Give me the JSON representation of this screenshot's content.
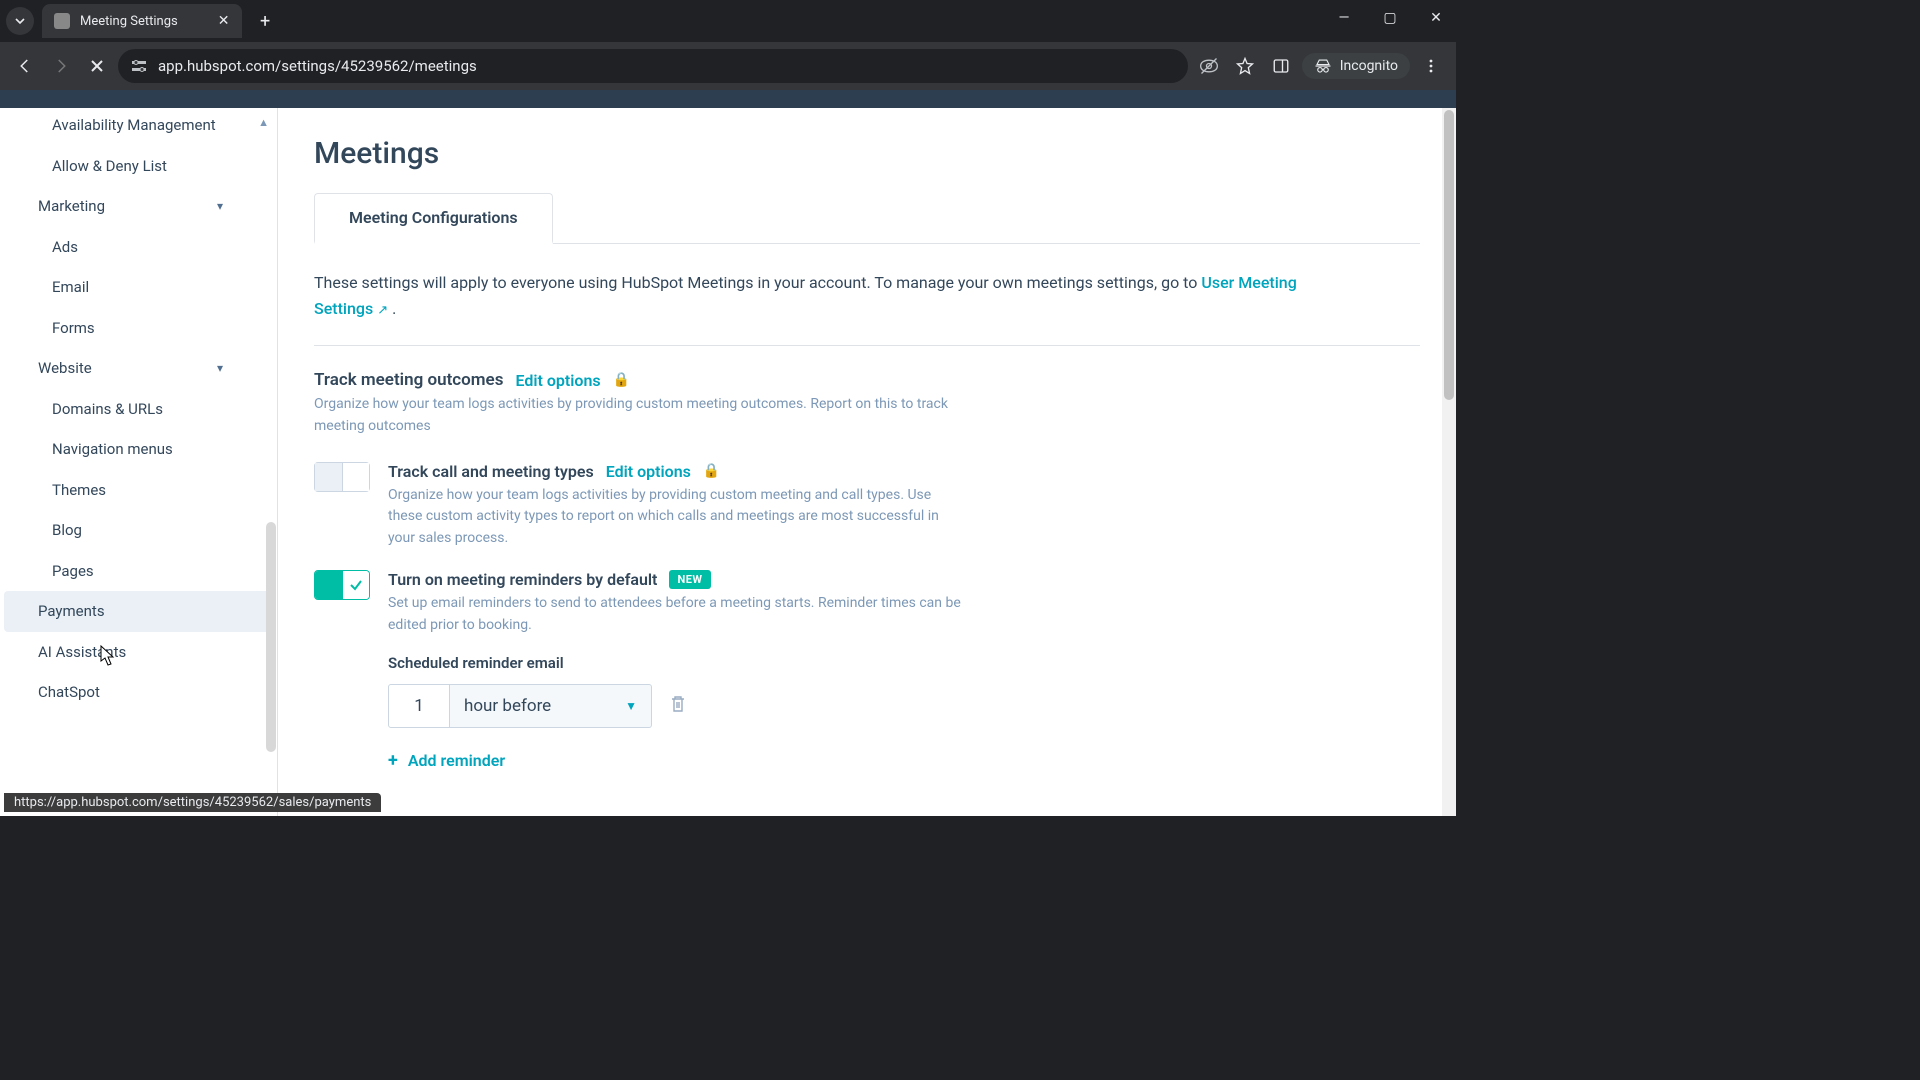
{
  "browser": {
    "tab_title": "Meeting Settings",
    "url": "app.hubspot.com/settings/45239562/meetings",
    "incognito_label": "Incognito",
    "status_url": "https://app.hubspot.com/settings/45239562/sales/payments"
  },
  "sidebar": {
    "items": [
      {
        "label": "Availability Management",
        "type": "leaf"
      },
      {
        "label": "Allow & Deny List",
        "type": "leaf"
      },
      {
        "label": "Marketing",
        "type": "group"
      },
      {
        "label": "Ads",
        "type": "sub"
      },
      {
        "label": "Email",
        "type": "sub"
      },
      {
        "label": "Forms",
        "type": "sub"
      },
      {
        "label": "Website",
        "type": "group"
      },
      {
        "label": "Domains & URLs",
        "type": "sub"
      },
      {
        "label": "Navigation menus",
        "type": "sub"
      },
      {
        "label": "Themes",
        "type": "sub"
      },
      {
        "label": "Blog",
        "type": "sub"
      },
      {
        "label": "Pages",
        "type": "sub"
      },
      {
        "label": "Payments",
        "type": "leaf",
        "active": true
      },
      {
        "label": "AI Assistants",
        "type": "leaf"
      },
      {
        "label": "ChatSpot",
        "type": "leaf"
      }
    ]
  },
  "page": {
    "title": "Meetings",
    "tab_label": "Meeting Configurations",
    "intro_prefix": "These settings will apply to everyone using HubSpot Meetings in your account. To manage your own meetings settings, go to ",
    "intro_link": "User Meeting Settings",
    "intro_suffix": " .",
    "track_outcomes": {
      "title": "Track meeting outcomes",
      "edit": "Edit options",
      "desc": "Organize how your team logs activities by providing custom meeting outcomes. Report on this to track meeting outcomes"
    },
    "track_types": {
      "title": "Track call and meeting types",
      "edit": "Edit options",
      "desc": "Organize how your team logs activities by providing custom meeting and call types. Use these custom activity types to report on which calls and meetings are most successful in your sales process."
    },
    "reminders": {
      "title": "Turn on meeting reminders by default",
      "badge": "NEW",
      "desc": "Set up email reminders to send to attendees before a meeting starts. Reminder times can be edited prior to booking.",
      "subhead": "Scheduled reminder email",
      "value": "1",
      "unit": "hour before",
      "add_label": "Add reminder"
    }
  }
}
